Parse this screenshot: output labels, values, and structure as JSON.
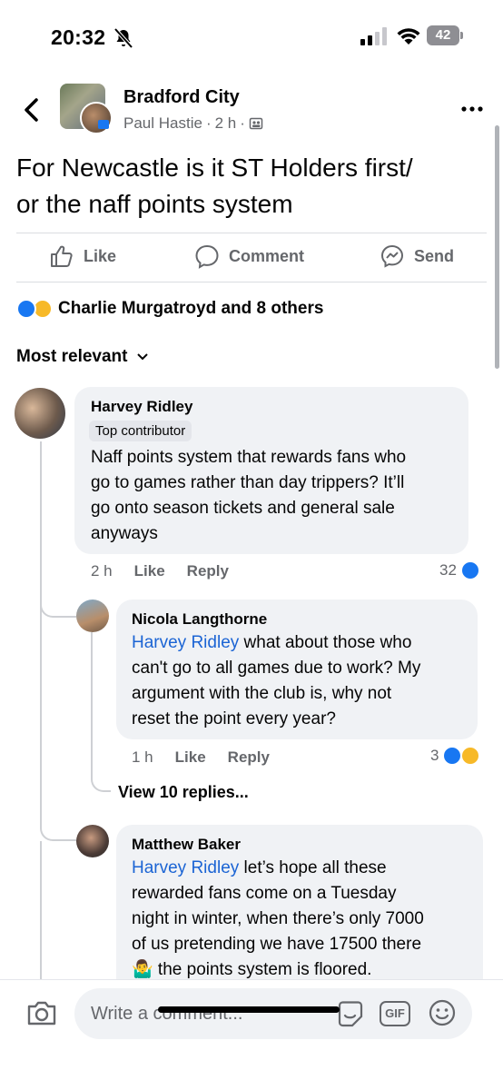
{
  "status": {
    "time": "20:32",
    "battery": "42",
    "icons": [
      "bell-slash-icon",
      "signal-icon",
      "wifi-icon",
      "battery-icon"
    ]
  },
  "header": {
    "group_name": "Bradford City",
    "author": "Paul Hastie",
    "separator": "·",
    "age": "2 h",
    "separator2": "·"
  },
  "post": {
    "text_line1": "For Newcastle is it ST Holders first/",
    "text_line2": "or the naff points system"
  },
  "actions": {
    "like": "Like",
    "comment": "Comment",
    "send": "Send"
  },
  "reactions": {
    "summary": "Charlie Murgatroyd and 8 others"
  },
  "sort": {
    "label": "Most relevant"
  },
  "comments": [
    {
      "name": "Harvey Ridley",
      "badge": "Top contributor",
      "lines": [
        "Naff points system that rewards fans who",
        "go to games rather than day trippers? It’ll",
        "go onto season tickets and general sale",
        "anyways"
      ],
      "time": "2 h",
      "like": "Like",
      "reply": "Reply",
      "reaction_count": "32"
    },
    {
      "name": "Nicola Langthorne",
      "mention": "Harvey Ridley",
      "lines": [
        " what about those who",
        "can't go to all games due to work? My",
        "argument with the club is, why not",
        "reset the point every year?"
      ],
      "time": "1 h",
      "like": "Like",
      "reply": "Reply",
      "reaction_count": "3"
    },
    {
      "name": "Matthew Baker",
      "mention": "Harvey Ridley",
      "lines": [
        " let’s hope all these",
        "rewarded fans come on a Tuesday",
        "night in winter, when there’s only 7000",
        "of us pretending we have 17500 there",
        "🤷‍♂️ the points system is floored."
      ]
    }
  ],
  "view_replies": "View 10 replies...",
  "composer": {
    "placeholder": "Write a comment...",
    "gif": "GIF"
  },
  "colors": {
    "accent": "#1877f2",
    "mention": "#1b64d4",
    "bubble": "#f0f2f5",
    "muted": "#65676b"
  }
}
